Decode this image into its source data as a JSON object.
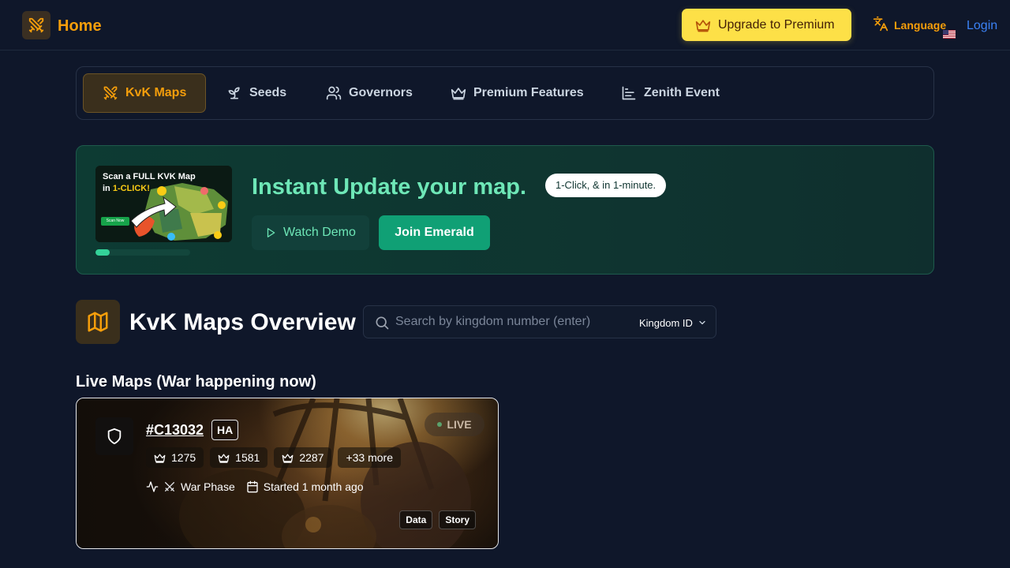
{
  "header": {
    "title": "Home",
    "premium_label": "Upgrade to Premium",
    "language_label": "Language",
    "login_label": "Login"
  },
  "nav": {
    "tabs": [
      {
        "label": "KvK Maps",
        "icon": "swords-icon",
        "active": true
      },
      {
        "label": "Seeds",
        "icon": "sprout-icon",
        "active": false
      },
      {
        "label": "Governors",
        "icon": "users-icon",
        "active": false
      },
      {
        "label": "Premium Features",
        "icon": "crown-icon",
        "active": false
      },
      {
        "label": "Zenith Event",
        "icon": "bar-chart-icon",
        "active": false
      }
    ]
  },
  "banner": {
    "thumbnail": {
      "title_line1": "Scan a FULL KVK Map",
      "title_line2_prefix": "in ",
      "title_line2_highlight": "1-CLICK!",
      "button_text": "Scan Now"
    },
    "headline": "Instant Update your map.",
    "pill": "1-Click, & in 1-minute.",
    "watch_demo_label": "Watch Demo",
    "join_label": "Join Emerald",
    "progress_percent": 15
  },
  "overview": {
    "title": "KvK Maps Overview",
    "search_placeholder": "Search by kingdom number (enter)",
    "select_value": "Kingdom ID"
  },
  "live": {
    "heading": "Live Maps (War happening now)",
    "cards": [
      {
        "id": "#C13032",
        "badge": "HA",
        "status": "LIVE",
        "kingdoms": [
          "1275",
          "1581",
          "2287"
        ],
        "more": "+33 more",
        "phase": "War Phase",
        "started": "Started 1 month ago",
        "tags": [
          "Data",
          "Story"
        ]
      }
    ]
  },
  "colors": {
    "accent": "#f59e0b",
    "premium": "#fde047",
    "emerald": "#10a075",
    "emerald_text": "#6ee7b7",
    "background": "#0f172a",
    "link": "#3b82f6"
  }
}
